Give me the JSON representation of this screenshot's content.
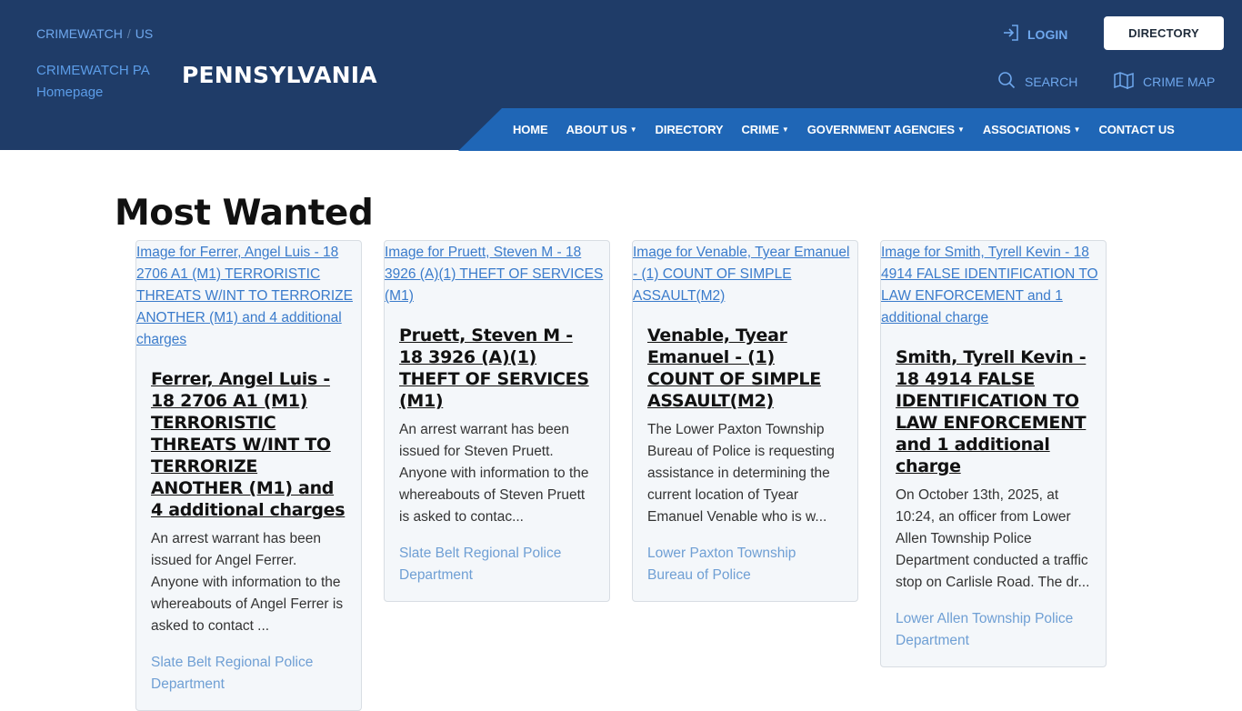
{
  "header": {
    "breadcrumb": [
      "CRIMEWATCH",
      "US"
    ],
    "logo_alt": "CRIMEWATCH PA Homepage",
    "state_title": "PENNSYLVANIA",
    "login_label": "LOGIN",
    "directory_button": "DIRECTORY",
    "search_label": "SEARCH",
    "crime_map_label": "CRIME MAP"
  },
  "nav": {
    "items": [
      {
        "label": "HOME",
        "dropdown": false
      },
      {
        "label": "ABOUT US",
        "dropdown": true
      },
      {
        "label": "DIRECTORY",
        "dropdown": false
      },
      {
        "label": "CRIME",
        "dropdown": true
      },
      {
        "label": "GOVERNMENT AGENCIES",
        "dropdown": true
      },
      {
        "label": "ASSOCIATIONS",
        "dropdown": true
      },
      {
        "label": "CONTACT US",
        "dropdown": false
      }
    ]
  },
  "main": {
    "title": "Most Wanted",
    "cards": [
      {
        "image_alt": "Image for Ferrer, Angel Luis - 18 2706 A1 (M1) TERRORISTIC THREATS W/INT TO TERRORIZE ANOTHER (M1) and 4 additional charges",
        "title": "Ferrer, Angel Luis - 18 2706 A1 (M1) TERRORISTIC THREATS W/INT TO TERRORIZE ANOTHER (M1) and 4 additional charges",
        "summary": "An arrest warrant has been issued for Angel Ferrer. Anyone with information to the whereabouts of Angel Ferrer is asked to contact ...",
        "agency": "Slate Belt Regional Police Department"
      },
      {
        "image_alt": "Image for Pruett, Steven M - 18 3926 (A)(1) THEFT OF SERVICES (M1)",
        "title": "Pruett, Steven M - 18 3926 (A)(1) THEFT OF SERVICES (M1)",
        "summary": "An arrest warrant has been issued for Steven Pruett. Anyone with information to the whereabouts of Steven Pruett is asked to contac...",
        "agency": "Slate Belt Regional Police Department"
      },
      {
        "image_alt": "Image for Venable, Tyear Emanuel - (1) COUNT OF SIMPLE ASSAULT(M2)",
        "title": "Venable, Tyear Emanuel - (1) COUNT OF SIMPLE ASSAULT(M2)",
        "summary": "The Lower Paxton Township Bureau of Police is requesting assistance in determining the current location of Tyear Emanuel Venable who is w...",
        "agency": "Lower Paxton Township Bureau of Police"
      },
      {
        "image_alt": "Image for Smith, Tyrell Kevin - 18 4914 FALSE IDENTIFICATION TO LAW ENFORCEMENT and 1 additional charge",
        "title": "Smith, Tyrell Kevin - 18 4914 FALSE IDENTIFICATION TO LAW ENFORCEMENT and 1 additional charge",
        "summary": "On October 13th, 2025, at 10:24, an officer from Lower Allen Township Police Department conducted a traffic stop on Carlisle Road. The dr...",
        "agency": "Lower Allen Township Police Department"
      }
    ]
  },
  "colors": {
    "header_bg": "#1f3c68",
    "nav_bg": "#1f66b6",
    "link_blue": "#6fa8ee",
    "card_bg": "#f4f7fa"
  }
}
